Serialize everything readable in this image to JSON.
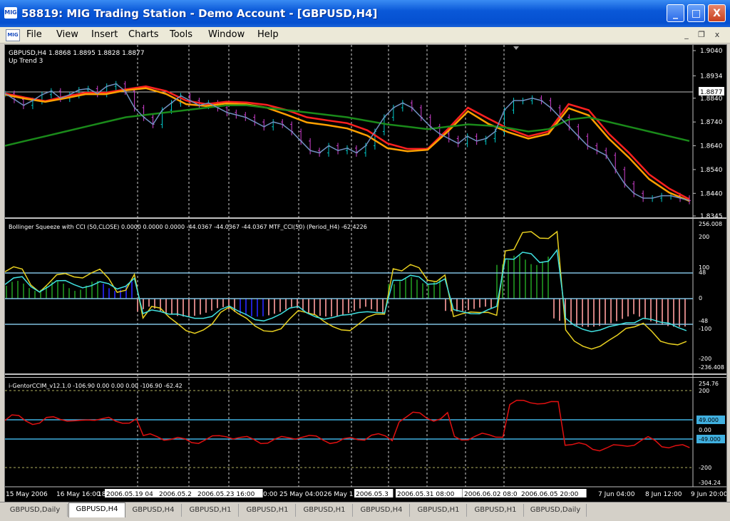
{
  "window": {
    "title": "58819: MIG Trading Station - Demo Account - [GBPUSD,H4]",
    "app_icon_text": "MIG",
    "minimize": "_",
    "maximize": "□",
    "close": "X"
  },
  "menu": {
    "items": [
      "File",
      "View",
      "Insert",
      "Charts",
      "Tools",
      "Window",
      "Help"
    ],
    "mdi_min": "_",
    "mdi_restore": "❐",
    "mdi_close": "x"
  },
  "chart": {
    "main_label": "GBPUSD,H4  1.8868 1.8895 1.8828 1.8877",
    "main_sub_label": "Up Trend 3",
    "price_levels": [
      "1.9040",
      "1.8934",
      "1.8840",
      "1.8740",
      "1.8640",
      "1.8540",
      "1.8440",
      "1.8345"
    ],
    "current_price": "1.8877",
    "ind1_label": "Bollinger Squeeze with CCI (50,CLOSE) 0.0000 0.0000 0.0000 -44.0367 -44.0367 -44.0367  MTF_CCI(50) (Period_H4) -62.4226",
    "ind1_levels": [
      "256.008",
      "200",
      "100",
      "48",
      "0",
      "-48",
      "-100",
      "-200",
      "-236.408"
    ],
    "ind2_label": "i-GentorCCIM_v12.1.0 -106.90 0.00 0.00 0.00 -106.90 -62.42",
    "ind2_levels": [
      "254.76",
      "200",
      "49.000",
      "0.00",
      "-49.000",
      "-200",
      "-304.24"
    ],
    "time_labels": [
      "15 May 2006",
      "16 May 16:00",
      "18",
      "2006.05.19 04",
      "2006.05.2",
      "2006.05.23 16:00",
      "0:00",
      "25 May 04:00",
      "26 May 1",
      "2006.05.3",
      "2006.05.31 08:00",
      "0",
      "2006.06.02 08:0",
      "2006.06.05 20:00",
      "7 Jun 04:00",
      "8 Jun 12:00",
      "9 Jun 20:00"
    ]
  },
  "chart_data": {
    "type": "line",
    "title": "GBPUSD,H4",
    "ylim": [
      1.8345,
      1.904
    ],
    "close": [
      1.886,
      1.8835,
      1.881,
      1.883,
      1.8855,
      1.887,
      1.884,
      1.8855,
      1.8875,
      1.888,
      1.886,
      1.889,
      1.89,
      1.887,
      1.88,
      1.876,
      1.873,
      1.879,
      1.882,
      1.885,
      1.883,
      1.881,
      1.882,
      1.88,
      1.878,
      1.877,
      1.876,
      1.874,
      1.872,
      1.874,
      1.873,
      1.87,
      1.866,
      1.862,
      1.861,
      1.864,
      1.862,
      1.863,
      1.861,
      1.864,
      1.87,
      1.876,
      1.88,
      1.882,
      1.88,
      1.876,
      1.872,
      1.869,
      1.867,
      1.865,
      1.868,
      1.866,
      1.867,
      1.87,
      1.879,
      1.883,
      1.883,
      1.884,
      1.883,
      1.88,
      1.876,
      1.872,
      1.868,
      1.864,
      1.862,
      1.86,
      1.854,
      1.848,
      1.844,
      1.842,
      1.842,
      1.843,
      1.843,
      1.842,
      1.841
    ],
    "bands": [
      {
        "name": "ma1",
        "color": "#ff2020",
        "values": [
          1.886,
          1.8843,
          1.8828,
          1.8847,
          1.8863,
          1.8863,
          1.8877,
          1.889,
          1.887,
          1.883,
          1.8815,
          1.8825,
          1.8822,
          1.8812,
          1.879,
          1.876,
          1.8747,
          1.8735,
          1.8705,
          1.865,
          1.8627,
          1.8627,
          1.871,
          1.88,
          1.8755,
          1.8712,
          1.868,
          1.87,
          1.8815,
          1.879,
          1.869,
          1.861,
          1.852,
          1.846,
          1.8415
        ]
      },
      {
        "name": "ma2",
        "color": "#ffa000",
        "values": [
          1.8855,
          1.8838,
          1.8825,
          1.884,
          1.8857,
          1.8857,
          1.8873,
          1.8882,
          1.8858,
          1.8815,
          1.8807,
          1.8818,
          1.8814,
          1.88,
          1.877,
          1.8738,
          1.8727,
          1.8713,
          1.8683,
          1.863,
          1.8617,
          1.8623,
          1.87,
          1.8785,
          1.8733,
          1.8697,
          1.867,
          1.869,
          1.8798,
          1.8768,
          1.867,
          1.859,
          1.85,
          1.8443,
          1.8408
        ]
      },
      {
        "name": "ma3",
        "color": "#1a8a1a",
        "values": [
          1.864,
          1.866,
          1.868,
          1.87,
          1.872,
          1.874,
          1.876,
          1.877,
          1.878,
          1.879,
          1.88,
          1.881,
          1.881,
          1.88,
          1.879,
          1.878,
          1.877,
          1.876,
          1.8745,
          1.873,
          1.872,
          1.871,
          1.872,
          1.873,
          1.8725,
          1.8715,
          1.87,
          1.871,
          1.875,
          1.876,
          1.874,
          1.872,
          1.87,
          1.868,
          1.866
        ]
      }
    ]
  },
  "tabs": [
    "GBPUSD,Daily",
    "GBPUSD,H4",
    "GBPUSD,H4",
    "GBPUSD,H1",
    "GBPUSD,H1",
    "GBPUSD,H1",
    "GBPUSD,H4",
    "GBPUSD,H1",
    "GBPUSD,H1",
    "GBPUSD,Daily"
  ],
  "active_tab": 1,
  "colors": {
    "candle_up": "#00c8c8",
    "candle_down": "#d040d0",
    "hist_up": "#1a7a1a",
    "hist_down": "#d08080",
    "hist_blue": "#2020d0",
    "cci_cyan": "#40e0e0",
    "cci_yellow": "#e8d020",
    "level_line": "#80c0e0",
    "ccim_red": "#e01010"
  }
}
